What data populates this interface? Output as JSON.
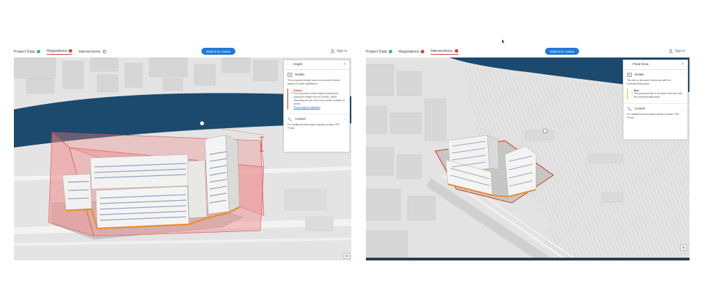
{
  "left": {
    "tabs": [
      {
        "label": "Project Data",
        "status": "ok"
      },
      {
        "label": "Regulations",
        "status": "error"
      },
      {
        "label": "Intersections",
        "status": "info"
      }
    ],
    "submit_label": "Submit for review",
    "signin_label": "Sign in",
    "panel": {
      "title": "Height",
      "details_label": "Details",
      "description": "The proposed height must not exceed 8 levels based on state regulations.",
      "status_title": "Failed",
      "status_body": "The proposed model height exceeds the maximum height limit of 8 levels. When assuming 4m per level your model contains 11 levels.",
      "status_link": "Show original regulation",
      "contact_label": "Contact",
      "contact_text": "For additional information please contact: IPR Praha"
    }
  },
  "right": {
    "tabs": [
      {
        "label": "Project Data",
        "status": "ok"
      },
      {
        "label": "Regulations",
        "status": "error"
      },
      {
        "label": "Intersections",
        "status": "error"
      }
    ],
    "submit_label": "Submit for review",
    "signin_label": "Sign in",
    "panel": {
      "title": "Flood Zone",
      "details_label": "Details",
      "description": "The site or structure intersects with the corresponding layer.",
      "status_title": "Site",
      "status_body": "The proposed site or structure intersect with the corresponding layer.",
      "contact_label": "Contact",
      "contact_text": "For additional information please contact: IPR Praha"
    }
  },
  "colors": {
    "accent": "#1f7ad6",
    "ok": "#35ac46",
    "error": "#d83020",
    "river": "#1c4a6e",
    "envelope": "#f08a8a"
  },
  "icons": [
    "person-icon",
    "back-icon",
    "close-icon",
    "details-icon",
    "phone-icon",
    "warning-icon",
    "chevron-icon",
    "north-arrow-icon"
  ]
}
